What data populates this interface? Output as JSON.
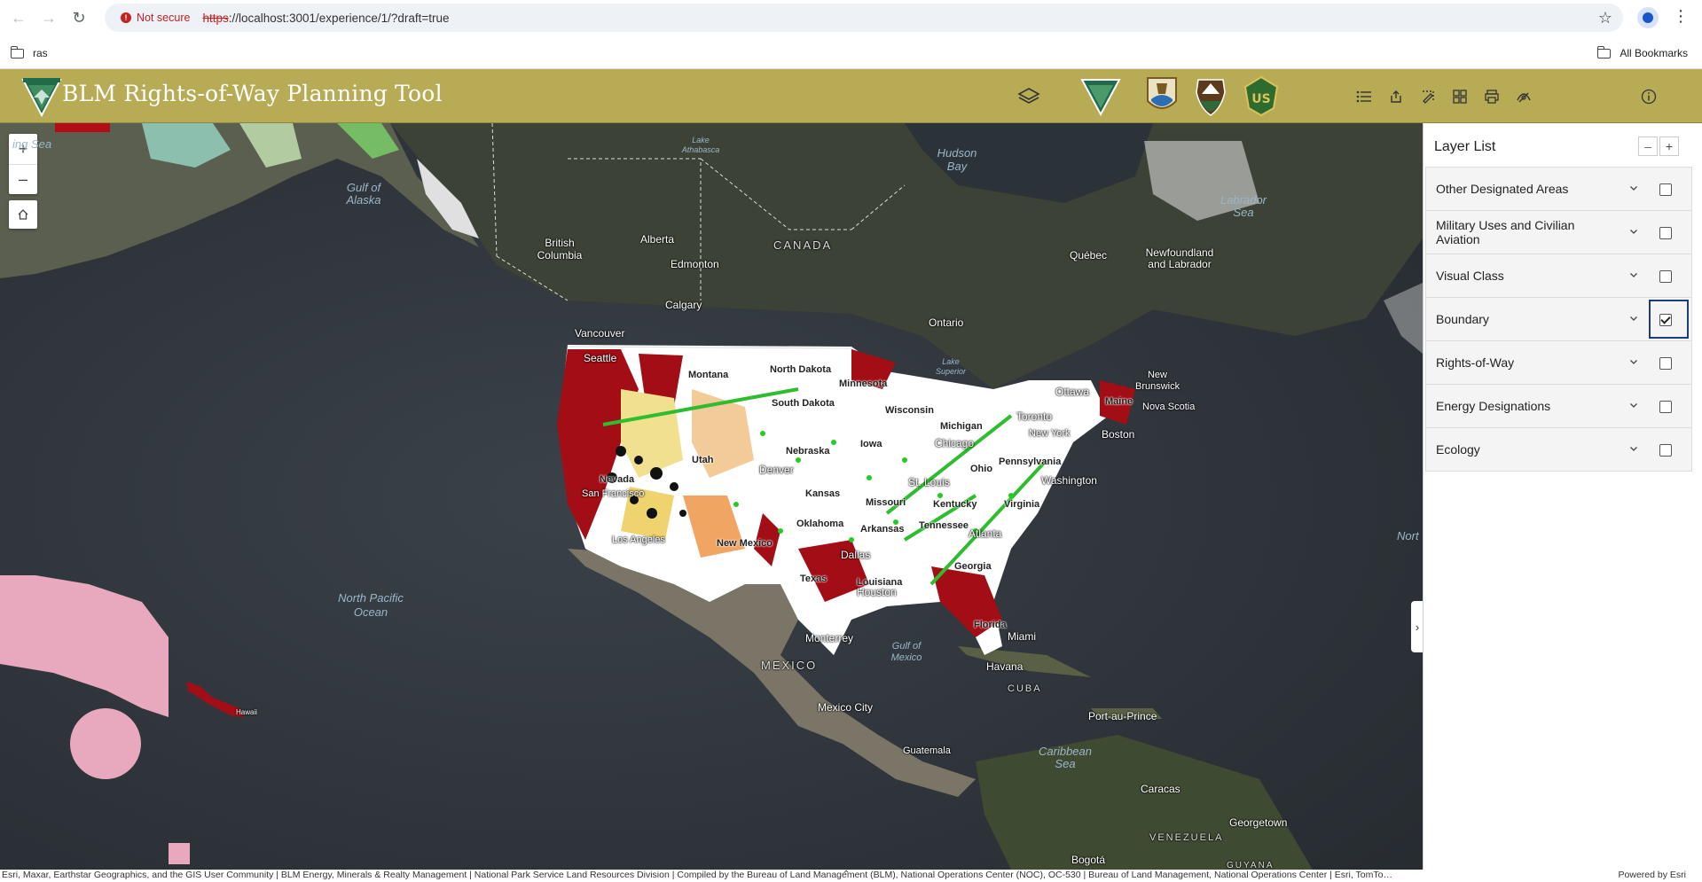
{
  "browser": {
    "security_label": "Not secure",
    "url_scheme": "https",
    "url_rest": "://localhost:3001/experience/1/?draft=true",
    "icons": [
      "back-icon",
      "forward-icon",
      "reload-icon",
      "star-icon",
      "profile-icon",
      "menu-icon"
    ]
  },
  "bookmarks": {
    "left_folder": "ras",
    "right_folder": "All Bookmarks"
  },
  "app": {
    "title": "BLM Rights-of-Way Planning Tool",
    "header_color": "#b7ab55",
    "toolbar_icons": [
      "layers-icon",
      "legend-icon",
      "share-icon",
      "draw-icon",
      "basemap-gallery-icon",
      "print-icon",
      "measure-icon",
      "info-icon"
    ],
    "agency_logos": [
      "blm-logo",
      "fws-logo",
      "nps-logo",
      "usfs-logo"
    ]
  },
  "map": {
    "zoom_in": "+",
    "zoom_out": "–",
    "labels": {
      "bering_sea": "ing Sea",
      "gulf_alaska": "Gulf of Alaska",
      "hudson_bay": "Hudson Bay",
      "labrador_sea": "Labrador Sea",
      "north_pacific": "North Pacific Ocean",
      "gulf_mexico": "Gulf of Mexico",
      "caribbean": "Caribbean Sea",
      "north_atlantic": "Nort",
      "canada": "CANADA",
      "mexico": "MEXICO",
      "cuba": "CUBA",
      "venezuela": "VENEZUELA",
      "guyana": "GUYANA",
      "british_columbia": "British Columbia",
      "alberta": "Alberta",
      "ontario": "Ontario",
      "quebec": "Québec",
      "newfoundland": "Newfoundland and Labrador",
      "lake_athabasca": "Lake Athabasca",
      "lake_superior": "Lake Superior",
      "new_brunswick": "New Brunswick",
      "nova_scotia": "Nova Scotia",
      "hawaii": "Hawaii"
    },
    "cities": {
      "edmonton": "Edmonton",
      "calgary": "Calgary",
      "vancouver": "Vancouver",
      "seattle": "Seattle",
      "ottawa": "Ottawa",
      "toronto": "Toronto",
      "new_york": "New York",
      "boston": "Boston",
      "chicago": "Chicago",
      "washington": "Washington",
      "st_louis": "St. Louis",
      "denver": "Denver",
      "atlanta": "Atlanta",
      "dallas": "Dallas",
      "houston": "Houston",
      "miami": "Miami",
      "havana": "Havana",
      "monterrey": "Monterrey",
      "mexico_city": "Mexico City",
      "guatemala": "Guatemala",
      "port_au_prince": "Port-au-Prince",
      "caracas": "Caracas",
      "georgetown": "Georgetown",
      "bogota": "Bogotá",
      "los_angeles": "Los Angeles",
      "san_francisco": "San Francisco"
    },
    "states": {
      "montana": "Montana",
      "north_dakota": "North Dakota",
      "south_dakota": "South Dakota",
      "minnesota": "Minnesota",
      "wisconsin": "Wisconsin",
      "michigan": "Michigan",
      "iowa": "Iowa",
      "nebraska": "Nebraska",
      "kansas": "Kansas",
      "missouri": "Missouri",
      "oklahoma": "Oklahoma",
      "arkansas": "Arkansas",
      "texas": "Texas",
      "louisiana": "Louisiana",
      "tennessee": "Tennessee",
      "kentucky": "Kentucky",
      "ohio": "Ohio",
      "virginia": "Virginia",
      "pennsylvania": "Pennsylvania",
      "georgia": "Georgia",
      "florida": "Florida",
      "maine": "Maine",
      "new_mexico": "New Mexico",
      "utah": "Utah",
      "nevada": "Nevada"
    },
    "attribution": "Esri, Maxar, Earthstar Geographics, and the GIS User Community | BLM Energy, Minerals & Realty Management | National Park Service Land Resources Division | Compiled by the Bureau of Land Management (BLM), National Operations Center (NOC), OC-530 | Bureau of Land Management, National Operations Center | Esri, TomTo…",
    "powered_by": "Powered by Esri"
  },
  "layer_list": {
    "title": "Layer List",
    "collapse_all": "–",
    "expand_all": "+",
    "items": [
      {
        "label": "Other Designated Areas",
        "checked": false
      },
      {
        "label": "Military Uses and Civilian Aviation",
        "checked": false
      },
      {
        "label": "Visual Class",
        "checked": false
      },
      {
        "label": "Boundary",
        "checked": true
      },
      {
        "label": "Rights-of-Way",
        "checked": false
      },
      {
        "label": "Energy Designations",
        "checked": false
      },
      {
        "label": "Ecology",
        "checked": false
      }
    ]
  }
}
